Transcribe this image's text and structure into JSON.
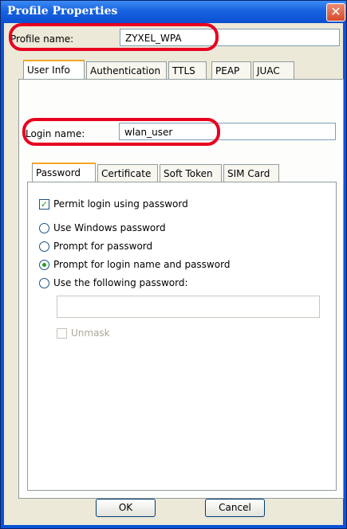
{
  "window": {
    "title": "Profile Properties",
    "close_glyph": "✕"
  },
  "profile": {
    "label": "Profile name:",
    "value": "ZYXEL_WPA"
  },
  "tabs": [
    {
      "label": "User Info",
      "active": true
    },
    {
      "label": "Authentication",
      "active": false
    },
    {
      "label": "TTLS",
      "active": false
    },
    {
      "label": "PEAP",
      "active": false
    },
    {
      "label": "JUAC",
      "active": false
    }
  ],
  "login": {
    "label": "Login name:",
    "value": "wlan_user"
  },
  "subtabs": [
    {
      "label": "Password",
      "active": true
    },
    {
      "label": "Certificate",
      "active": false
    },
    {
      "label": "Soft Token",
      "active": false
    },
    {
      "label": "SIM Card",
      "active": false
    }
  ],
  "password": {
    "permit_label": "Permit login using password",
    "permit_checked": true,
    "options": [
      {
        "label": "Use Windows password",
        "selected": false
      },
      {
        "label": "Prompt for password",
        "selected": false
      },
      {
        "label": "Prompt for login name and password",
        "selected": true
      },
      {
        "label": "Use the following password:",
        "selected": false
      }
    ],
    "password_value": "",
    "unmask_label": "Unmask",
    "unmask_checked": false
  },
  "buttons": {
    "ok": "OK",
    "cancel": "Cancel"
  },
  "colors": {
    "highlight": "#e8001f",
    "titlebar": "#0a53d8",
    "dialog_bg": "#ece9d8",
    "tab_accent": "#f5a623"
  }
}
